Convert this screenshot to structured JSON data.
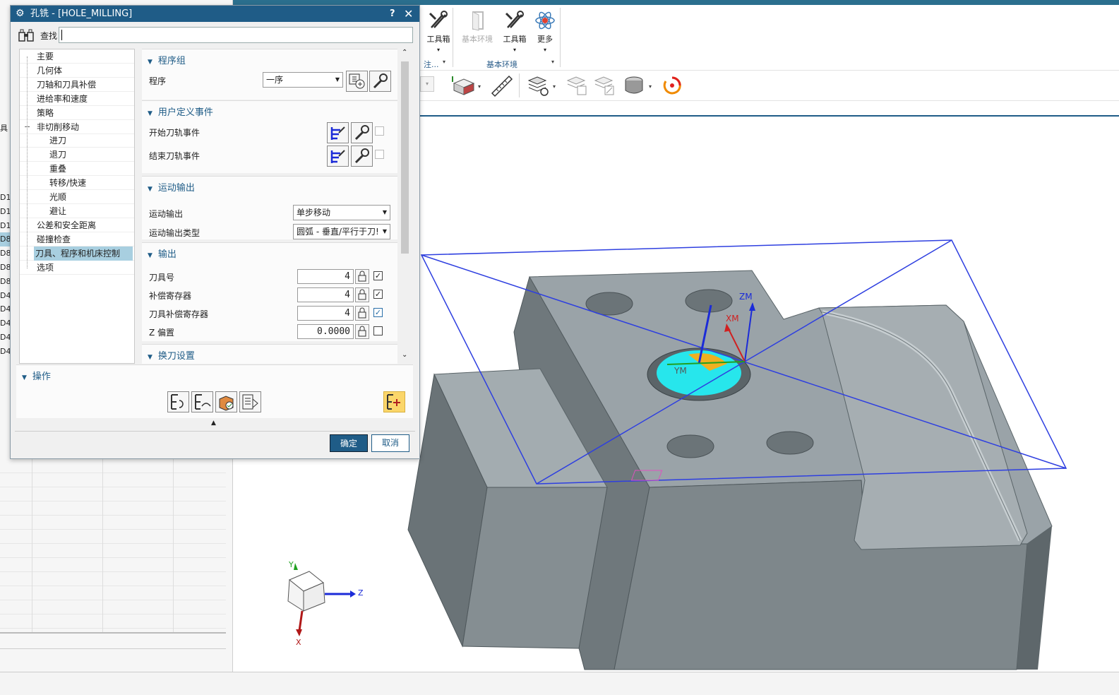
{
  "dialog": {
    "title": "孔铣 - [HOLE_MILLING]",
    "help": "?",
    "close": "✕",
    "find_label": "查找",
    "find_value": "",
    "ok": "确定",
    "cancel": "取消",
    "operations_header": "操作"
  },
  "tree": [
    {
      "label": "主要",
      "level": 0,
      "selected": false
    },
    {
      "label": "几何体",
      "level": 0,
      "selected": false
    },
    {
      "label": "刀轴和刀具补偿",
      "level": 0,
      "selected": false
    },
    {
      "label": "进给率和速度",
      "level": 0,
      "selected": false
    },
    {
      "label": "策略",
      "level": 0,
      "selected": false
    },
    {
      "label": "非切削移动",
      "level": 0,
      "selected": false,
      "expander": "−"
    },
    {
      "label": "进刀",
      "level": 1,
      "selected": false
    },
    {
      "label": "退刀",
      "level": 1,
      "selected": false
    },
    {
      "label": "重叠",
      "level": 1,
      "selected": false
    },
    {
      "label": "转移/快速",
      "level": 1,
      "selected": false
    },
    {
      "label": "光顺",
      "level": 1,
      "selected": false
    },
    {
      "label": "避让",
      "level": 1,
      "selected": false
    },
    {
      "label": "公差和安全距离",
      "level": 0,
      "selected": false
    },
    {
      "label": "碰撞检查",
      "level": 0,
      "selected": false
    },
    {
      "label": "刀具、程序和机床控制",
      "level": 0,
      "selected": true
    },
    {
      "label": "选项",
      "level": 0,
      "selected": false
    }
  ],
  "sections": {
    "program_group": {
      "header": "程序组",
      "program_label": "程序",
      "program_value": "一序"
    },
    "user_events": {
      "header": "用户定义事件",
      "start_label": "开始刀轨事件",
      "end_label": "结束刀轨事件"
    },
    "motion_output": {
      "header": "运动输出",
      "output_label": "运动输出",
      "output_value": "单步移动",
      "type_label": "运动输出类型",
      "type_value": "圆弧 - 垂直/平行于刀!"
    },
    "output": {
      "header": "输出",
      "tool_number_label": "刀具号",
      "tool_number": "4",
      "comp_register_label": "补偿寄存器",
      "comp_register": "4",
      "tool_comp_register_label": "刀具补偿寄存器",
      "tool_comp_register": "4",
      "z_offset_label": "Z 偏置",
      "z_offset": "0.0000"
    },
    "tool_change": {
      "header": "换刀设置"
    }
  },
  "ribbon": {
    "buttons": [
      {
        "label": "工具箱",
        "enabled": true
      },
      {
        "label": "基本环境",
        "enabled": false
      },
      {
        "label": "工具箱",
        "enabled": true
      },
      {
        "label": "更多",
        "enabled": true
      }
    ],
    "group_left": "注...",
    "group_right": "基本环境"
  },
  "left_cells": [
    "具",
    "D1",
    "D1",
    "D1",
    "D8",
    "D8",
    "D8",
    "D8",
    "D4",
    "D4",
    "D4",
    "D4",
    "D4"
  ],
  "triad": {
    "x": "X",
    "y": "Y",
    "z": "Z"
  },
  "csys": {
    "zm": "ZM",
    "xm": "XM",
    "ym": "YM"
  },
  "colors": {
    "accent": "#1f5c87",
    "selection": "#a8cfe0",
    "model": "#8b959b",
    "hole_highlight": "#27e6ec"
  }
}
